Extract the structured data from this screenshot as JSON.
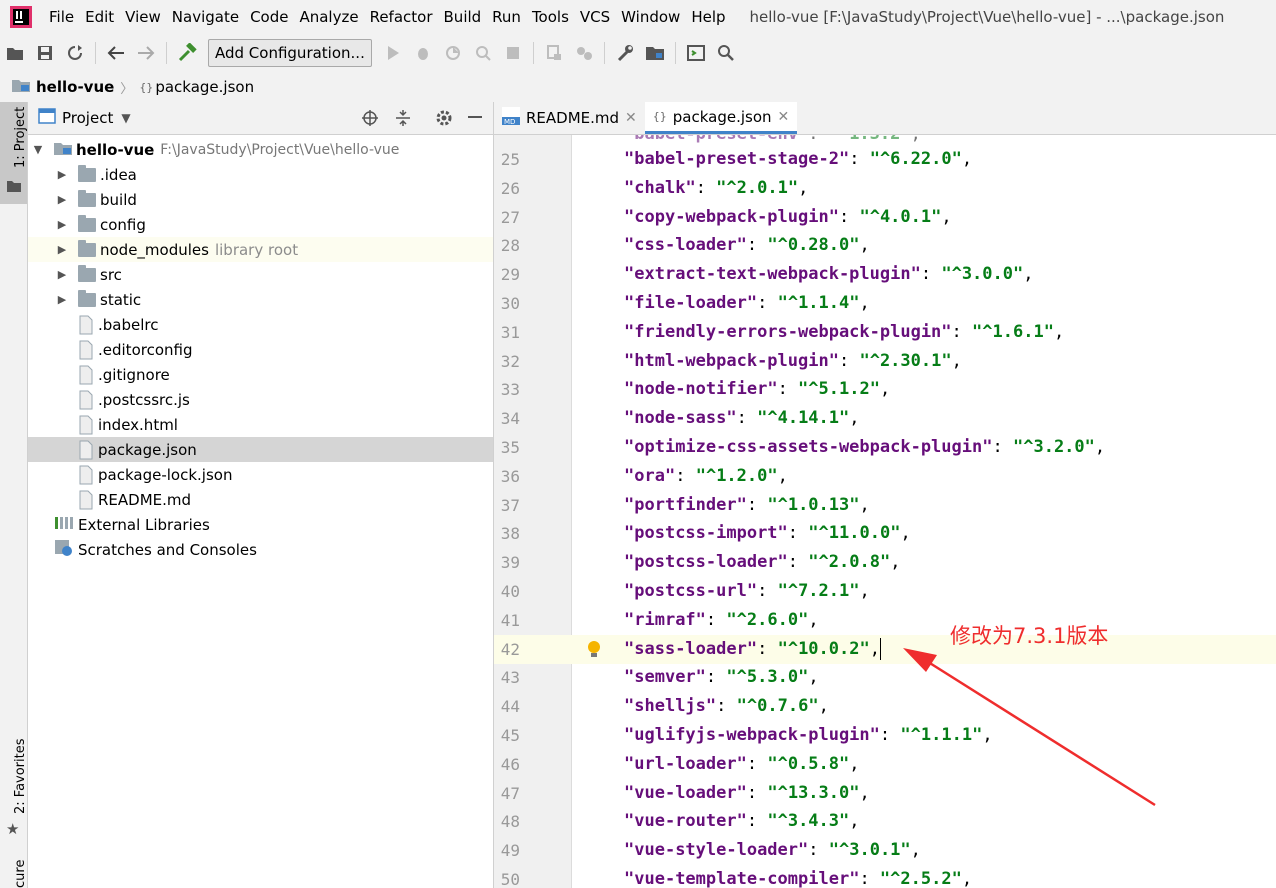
{
  "menubar": {
    "items": [
      "File",
      "Edit",
      "View",
      "Navigate",
      "Code",
      "Analyze",
      "Refactor",
      "Build",
      "Run",
      "Tools",
      "VCS",
      "Window",
      "Help"
    ],
    "window_title": "hello-vue [F:\\JavaStudy\\Project\\Vue\\hello-vue] - ...\\package.json"
  },
  "toolbar": {
    "add_configuration_label": "Add Configuration..."
  },
  "navbar": {
    "project": "hello-vue",
    "file": "package.json"
  },
  "left_stripe": {
    "project_label": "1: Project",
    "favorites_label": "2: Favorites",
    "bottom_label": "cure"
  },
  "project_panel": {
    "title": "Project",
    "root": {
      "name": "hello-vue",
      "path": "F:\\JavaStudy\\Project\\Vue\\hello-vue"
    },
    "items": [
      {
        "label": ".idea",
        "extra": ""
      },
      {
        "label": "build",
        "extra": ""
      },
      {
        "label": "config",
        "extra": ""
      },
      {
        "label": "node_modules",
        "extra": "library root"
      },
      {
        "label": "src",
        "extra": ""
      },
      {
        "label": "static",
        "extra": ""
      },
      {
        "label": ".babelrc",
        "extra": ""
      },
      {
        "label": ".editorconfig",
        "extra": ""
      },
      {
        "label": ".gitignore",
        "extra": ""
      },
      {
        "label": ".postcssrc.js",
        "extra": ""
      },
      {
        "label": "index.html",
        "extra": ""
      },
      {
        "label": "package.json",
        "extra": ""
      },
      {
        "label": "package-lock.json",
        "extra": ""
      },
      {
        "label": "README.md",
        "extra": ""
      }
    ],
    "external_libraries": "External Libraries",
    "scratches": "Scratches and Consoles"
  },
  "editor": {
    "tabs": [
      {
        "label": "README.md",
        "active": false
      },
      {
        "label": "package.json",
        "active": true
      }
    ],
    "lines": [
      {
        "n": "25",
        "key": "babel-preset-stage-2",
        "val": "^6.22.0"
      },
      {
        "n": "26",
        "key": "chalk",
        "val": "^2.0.1"
      },
      {
        "n": "27",
        "key": "copy-webpack-plugin",
        "val": "^4.0.1"
      },
      {
        "n": "28",
        "key": "css-loader",
        "val": "^0.28.0"
      },
      {
        "n": "29",
        "key": "extract-text-webpack-plugin",
        "val": "^3.0.0"
      },
      {
        "n": "30",
        "key": "file-loader",
        "val": "^1.1.4"
      },
      {
        "n": "31",
        "key": "friendly-errors-webpack-plugin",
        "val": "^1.6.1"
      },
      {
        "n": "32",
        "key": "html-webpack-plugin",
        "val": "^2.30.1"
      },
      {
        "n": "33",
        "key": "node-notifier",
        "val": "^5.1.2"
      },
      {
        "n": "34",
        "key": "node-sass",
        "val": "^4.14.1"
      },
      {
        "n": "35",
        "key": "optimize-css-assets-webpack-plugin",
        "val": "^3.2.0"
      },
      {
        "n": "36",
        "key": "ora",
        "val": "^1.2.0"
      },
      {
        "n": "37",
        "key": "portfinder",
        "val": "^1.0.13"
      },
      {
        "n": "38",
        "key": "postcss-import",
        "val": "^11.0.0"
      },
      {
        "n": "39",
        "key": "postcss-loader",
        "val": "^2.0.8"
      },
      {
        "n": "40",
        "key": "postcss-url",
        "val": "^7.2.1"
      },
      {
        "n": "41",
        "key": "rimraf",
        "val": "^2.6.0"
      },
      {
        "n": "42",
        "key": "sass-loader",
        "val": "^10.0.2"
      },
      {
        "n": "43",
        "key": "semver",
        "val": "^5.3.0"
      },
      {
        "n": "44",
        "key": "shelljs",
        "val": "^0.7.6"
      },
      {
        "n": "45",
        "key": "uglifyjs-webpack-plugin",
        "val": "^1.1.1"
      },
      {
        "n": "46",
        "key": "url-loader",
        "val": "^0.5.8"
      },
      {
        "n": "47",
        "key": "vue-loader",
        "val": "^13.3.0"
      },
      {
        "n": "48",
        "key": "vue-router",
        "val": "^3.4.3"
      },
      {
        "n": "49",
        "key": "vue-style-loader",
        "val": "^3.0.1"
      },
      {
        "n": "50",
        "key": "vue-template-compiler",
        "val": "^2.5.2"
      }
    ],
    "current_line": "42"
  },
  "annotation": {
    "text": "修改为7.3.1版本",
    "color": "#ef2d2d"
  },
  "colors": {
    "accent": "#4083c9",
    "key": "#660e7a",
    "string": "#067d17"
  }
}
